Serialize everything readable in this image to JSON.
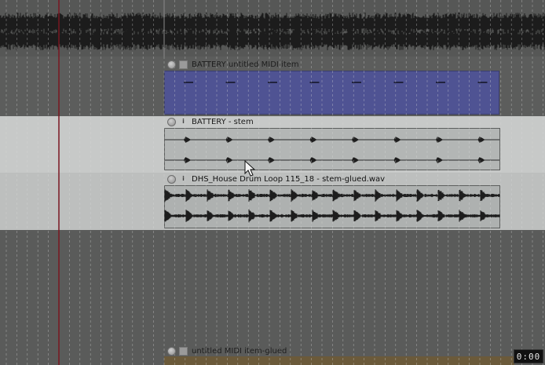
{
  "items": [
    {
      "id": "midi",
      "title": "BATTERY untitled MIDI item",
      "type": "midi"
    },
    {
      "id": "stem",
      "title": "BATTERY - stem",
      "type": "audio"
    },
    {
      "id": "loop",
      "title": "DHS_House Drum Loop 115_18 - stem-glued.wav",
      "type": "audio"
    },
    {
      "id": "glued",
      "title": "untitled MIDI item-glued",
      "type": "midi"
    }
  ],
  "icons": {
    "mute": "round-button-icon",
    "info": "i",
    "cursor": "mouse-pointer-icon"
  },
  "colors": {
    "background": "#5b5c5b",
    "selected_track": "#c4c6c5",
    "midi_item": "#4e5290",
    "audio_item": "#aeb1b0",
    "playhead": "#7a1620",
    "glued_item": "#6b5a3a"
  },
  "time_display": "0:00"
}
